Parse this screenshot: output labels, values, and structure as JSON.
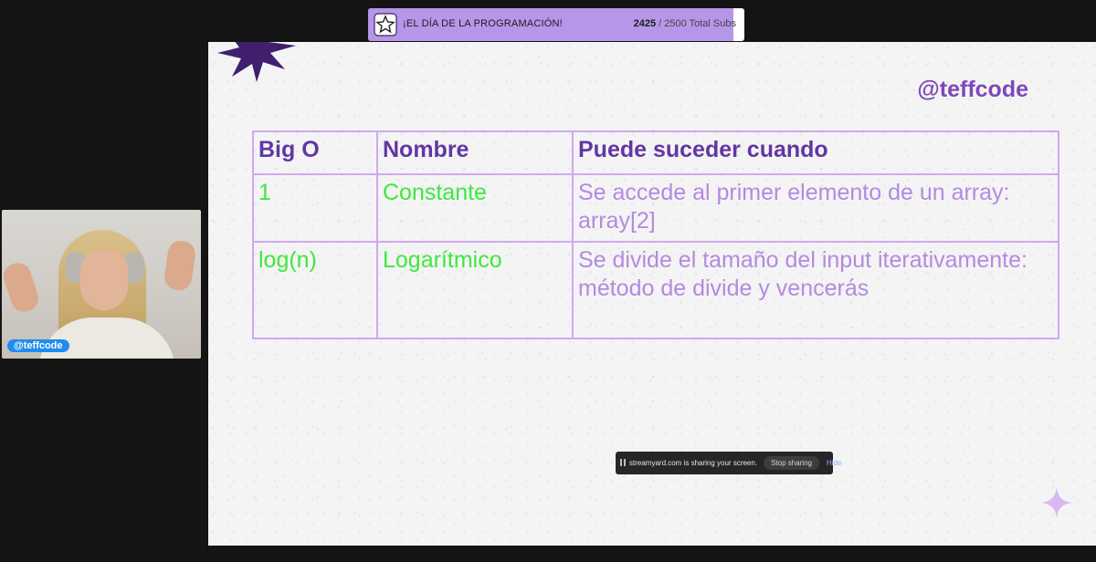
{
  "banner": {
    "title": "¡EL DÍA DE LA PROGRAMACIÓN!",
    "current": "2425",
    "total": " / 2500 Total Subs",
    "progress_fraction": 0.97,
    "icon": "star-badge-icon"
  },
  "camera": {
    "name_tag": "@teffcode"
  },
  "slide": {
    "handle": "@teffcode",
    "table": {
      "headers": [
        "Big O",
        "Nombre",
        "Puede suceder cuando"
      ],
      "rows": [
        {
          "big_o": "1",
          "name": "Constante",
          "when": "Se accede al primer elemento de un array: array[2]"
        },
        {
          "big_o": "log(n)",
          "name": "Logarítmico",
          "when": "Se divide el tamaño del input iterativamente: método de divide y vencerás"
        }
      ]
    }
  },
  "sharing": {
    "text": "streamyard.com is sharing your screen.",
    "stop_label": "Stop sharing",
    "hide_label": "Hide"
  },
  "colors": {
    "accent_purple": "#7e47b9",
    "banner_fill": "#b696e8",
    "table_border": "#cfa8ef",
    "green_text": "#3ee83e",
    "light_purple_text": "#b38ae0"
  }
}
